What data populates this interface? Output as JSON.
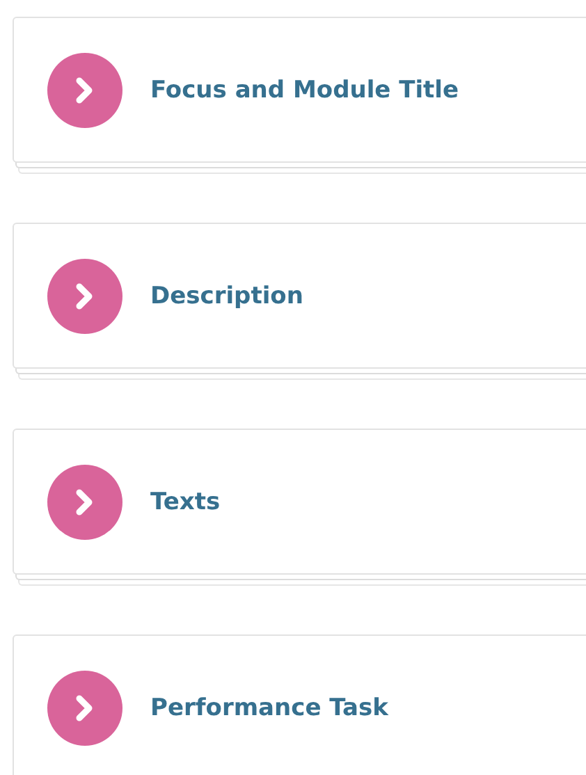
{
  "sections": [
    {
      "title": "Focus and Module Title",
      "expanded": false
    },
    {
      "title": "Description",
      "expanded": false
    },
    {
      "title": "Texts",
      "expanded": false
    },
    {
      "title": "Performance Task",
      "expanded": false
    }
  ]
}
